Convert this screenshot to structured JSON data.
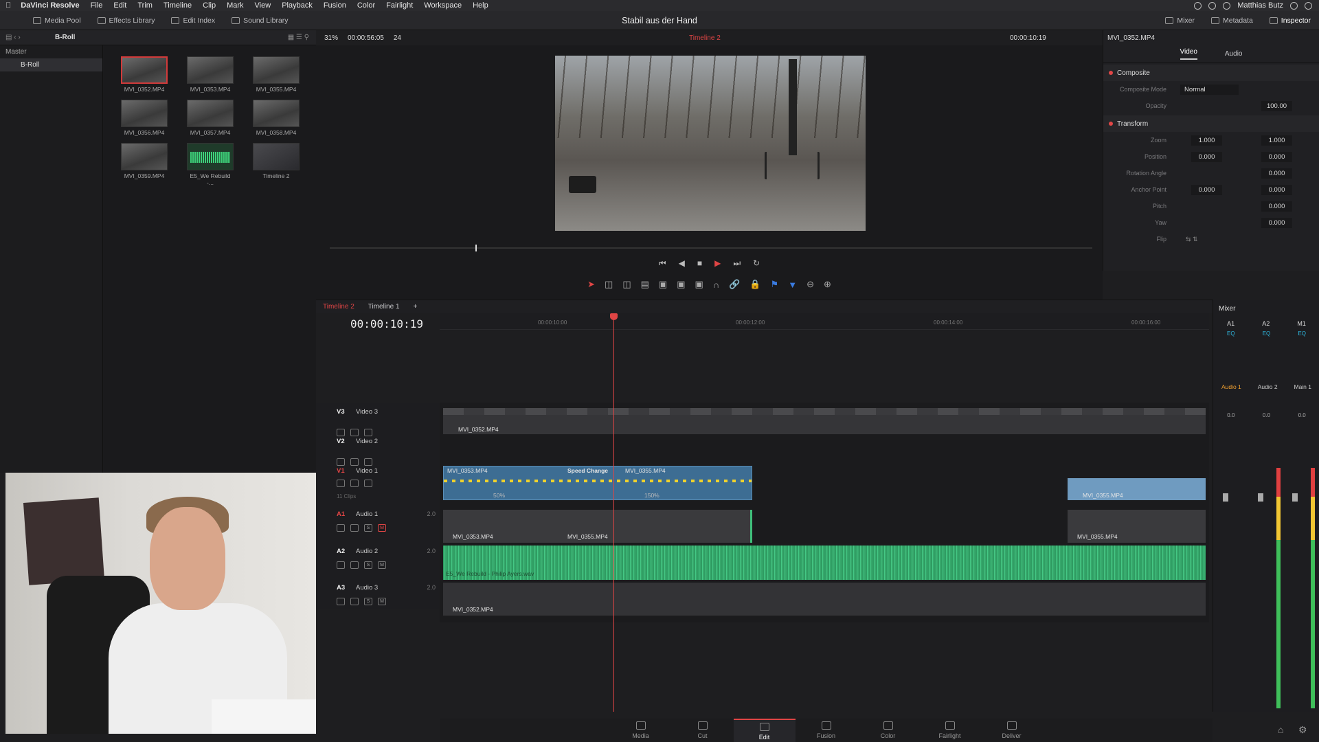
{
  "menubar": {
    "app": "DaVinci Resolve",
    "items": [
      "File",
      "Edit",
      "Trim",
      "Timeline",
      "Clip",
      "Mark",
      "View",
      "Playback",
      "Fusion",
      "Color",
      "Fairlight",
      "Workspace",
      "Help"
    ],
    "user": "Matthias Butz"
  },
  "toolbar": {
    "media_pool": "Media Pool",
    "effects_library": "Effects Library",
    "edit_index": "Edit Index",
    "sound_library": "Sound Library",
    "project_title": "Stabil aus der Hand",
    "mixer": "Mixer",
    "metadata": "Metadata",
    "inspector": "Inspector"
  },
  "media_pool": {
    "bin_name": "B-Roll",
    "zoom": "31%",
    "duration": "00:00:56:05",
    "fps": "24",
    "bins": [
      "Master",
      "B-Roll"
    ],
    "clips": [
      {
        "name": "MVI_0352.MP4",
        "kind": "video",
        "selected": true
      },
      {
        "name": "MVI_0353.MP4",
        "kind": "video"
      },
      {
        "name": "MVI_0355.MP4",
        "kind": "video"
      },
      {
        "name": "MVI_0356.MP4",
        "kind": "video"
      },
      {
        "name": "MVI_0357.MP4",
        "kind": "video"
      },
      {
        "name": "MVI_0358.MP4",
        "kind": "video"
      },
      {
        "name": "MVI_0359.MP4",
        "kind": "video"
      },
      {
        "name": "E5_We Rebuild -...",
        "kind": "audio"
      },
      {
        "name": "Timeline 2",
        "kind": "timeline"
      }
    ]
  },
  "viewer": {
    "timeline_name": "Timeline 2",
    "timecode": "00:00:10:19",
    "clip_name": "MVI_0352.MP4"
  },
  "inspector": {
    "tabs": [
      "Video",
      "Audio"
    ],
    "composite": {
      "title": "Composite",
      "mode_label": "Composite Mode",
      "mode_value": "Normal",
      "opacity_label": "Opacity",
      "opacity_value": "100.00"
    },
    "transform": {
      "title": "Transform",
      "zoom_label": "Zoom",
      "zoom_x": "1.000",
      "zoom_y": "1.000",
      "position_label": "Position",
      "position_x": "0.000",
      "position_y": "0.000",
      "rotation_label": "Rotation Angle",
      "rotation_value": "0.000",
      "anchor_label": "Anchor Point",
      "anchor_x": "0.000",
      "anchor_y": "0.000",
      "pitch_label": "Pitch",
      "pitch_value": "0.000",
      "yaw_label": "Yaw",
      "yaw_value": "0.000",
      "flip_label": "Flip"
    }
  },
  "timeline": {
    "tabs": [
      "Timeline 2",
      "Timeline 1"
    ],
    "timecode": "00:00:10:19",
    "ruler": [
      "00:00:10:00",
      "00:00:12:00",
      "00:00:14:00",
      "00:00:16:00"
    ],
    "tracks": [
      {
        "tag": "V3",
        "name": "Video 3"
      },
      {
        "tag": "V2",
        "name": "Video 2"
      },
      {
        "tag": "V1",
        "name": "Video 1",
        "sub": "11 Clips"
      },
      {
        "tag": "A1",
        "name": "Audio 1",
        "ch": "2.0"
      },
      {
        "tag": "A2",
        "name": "Audio 2",
        "ch": "2.0"
      },
      {
        "tag": "A3",
        "name": "Audio 3",
        "ch": "2.0"
      }
    ],
    "clips": {
      "v3": "MVI_0352.MP4",
      "v1a": "MVI_0353.MP4",
      "v1b": "Speed Change",
      "v1c": "MVI_0355.MP4",
      "v1a_speed": "50%",
      "v1c_speed": "150%",
      "v1d": "MVI_0355.MP4",
      "a1a": "MVI_0353.MP4",
      "a1b": "MVI_0355.MP4",
      "a1c": "MVI_0355.MP4",
      "a2": "E5_We Rebuild - Philip Ayers.wav",
      "a3": "MVI_0352.MP4"
    }
  },
  "mixer": {
    "title": "Mixer",
    "channels": [
      "A1",
      "A2",
      "M1"
    ],
    "names": [
      "Audio 1",
      "Audio 2",
      "Main 1"
    ],
    "eq": "EQ",
    "levels": [
      "0.0",
      "0.0",
      "0.0"
    ]
  },
  "pages": [
    "Media",
    "Cut",
    "Edit",
    "Fusion",
    "Color",
    "Fairlight",
    "Deliver"
  ],
  "colors": {
    "accent": "#e04545",
    "clip_blue": "#4a7fa8",
    "audio_green": "#3fbf7a"
  }
}
